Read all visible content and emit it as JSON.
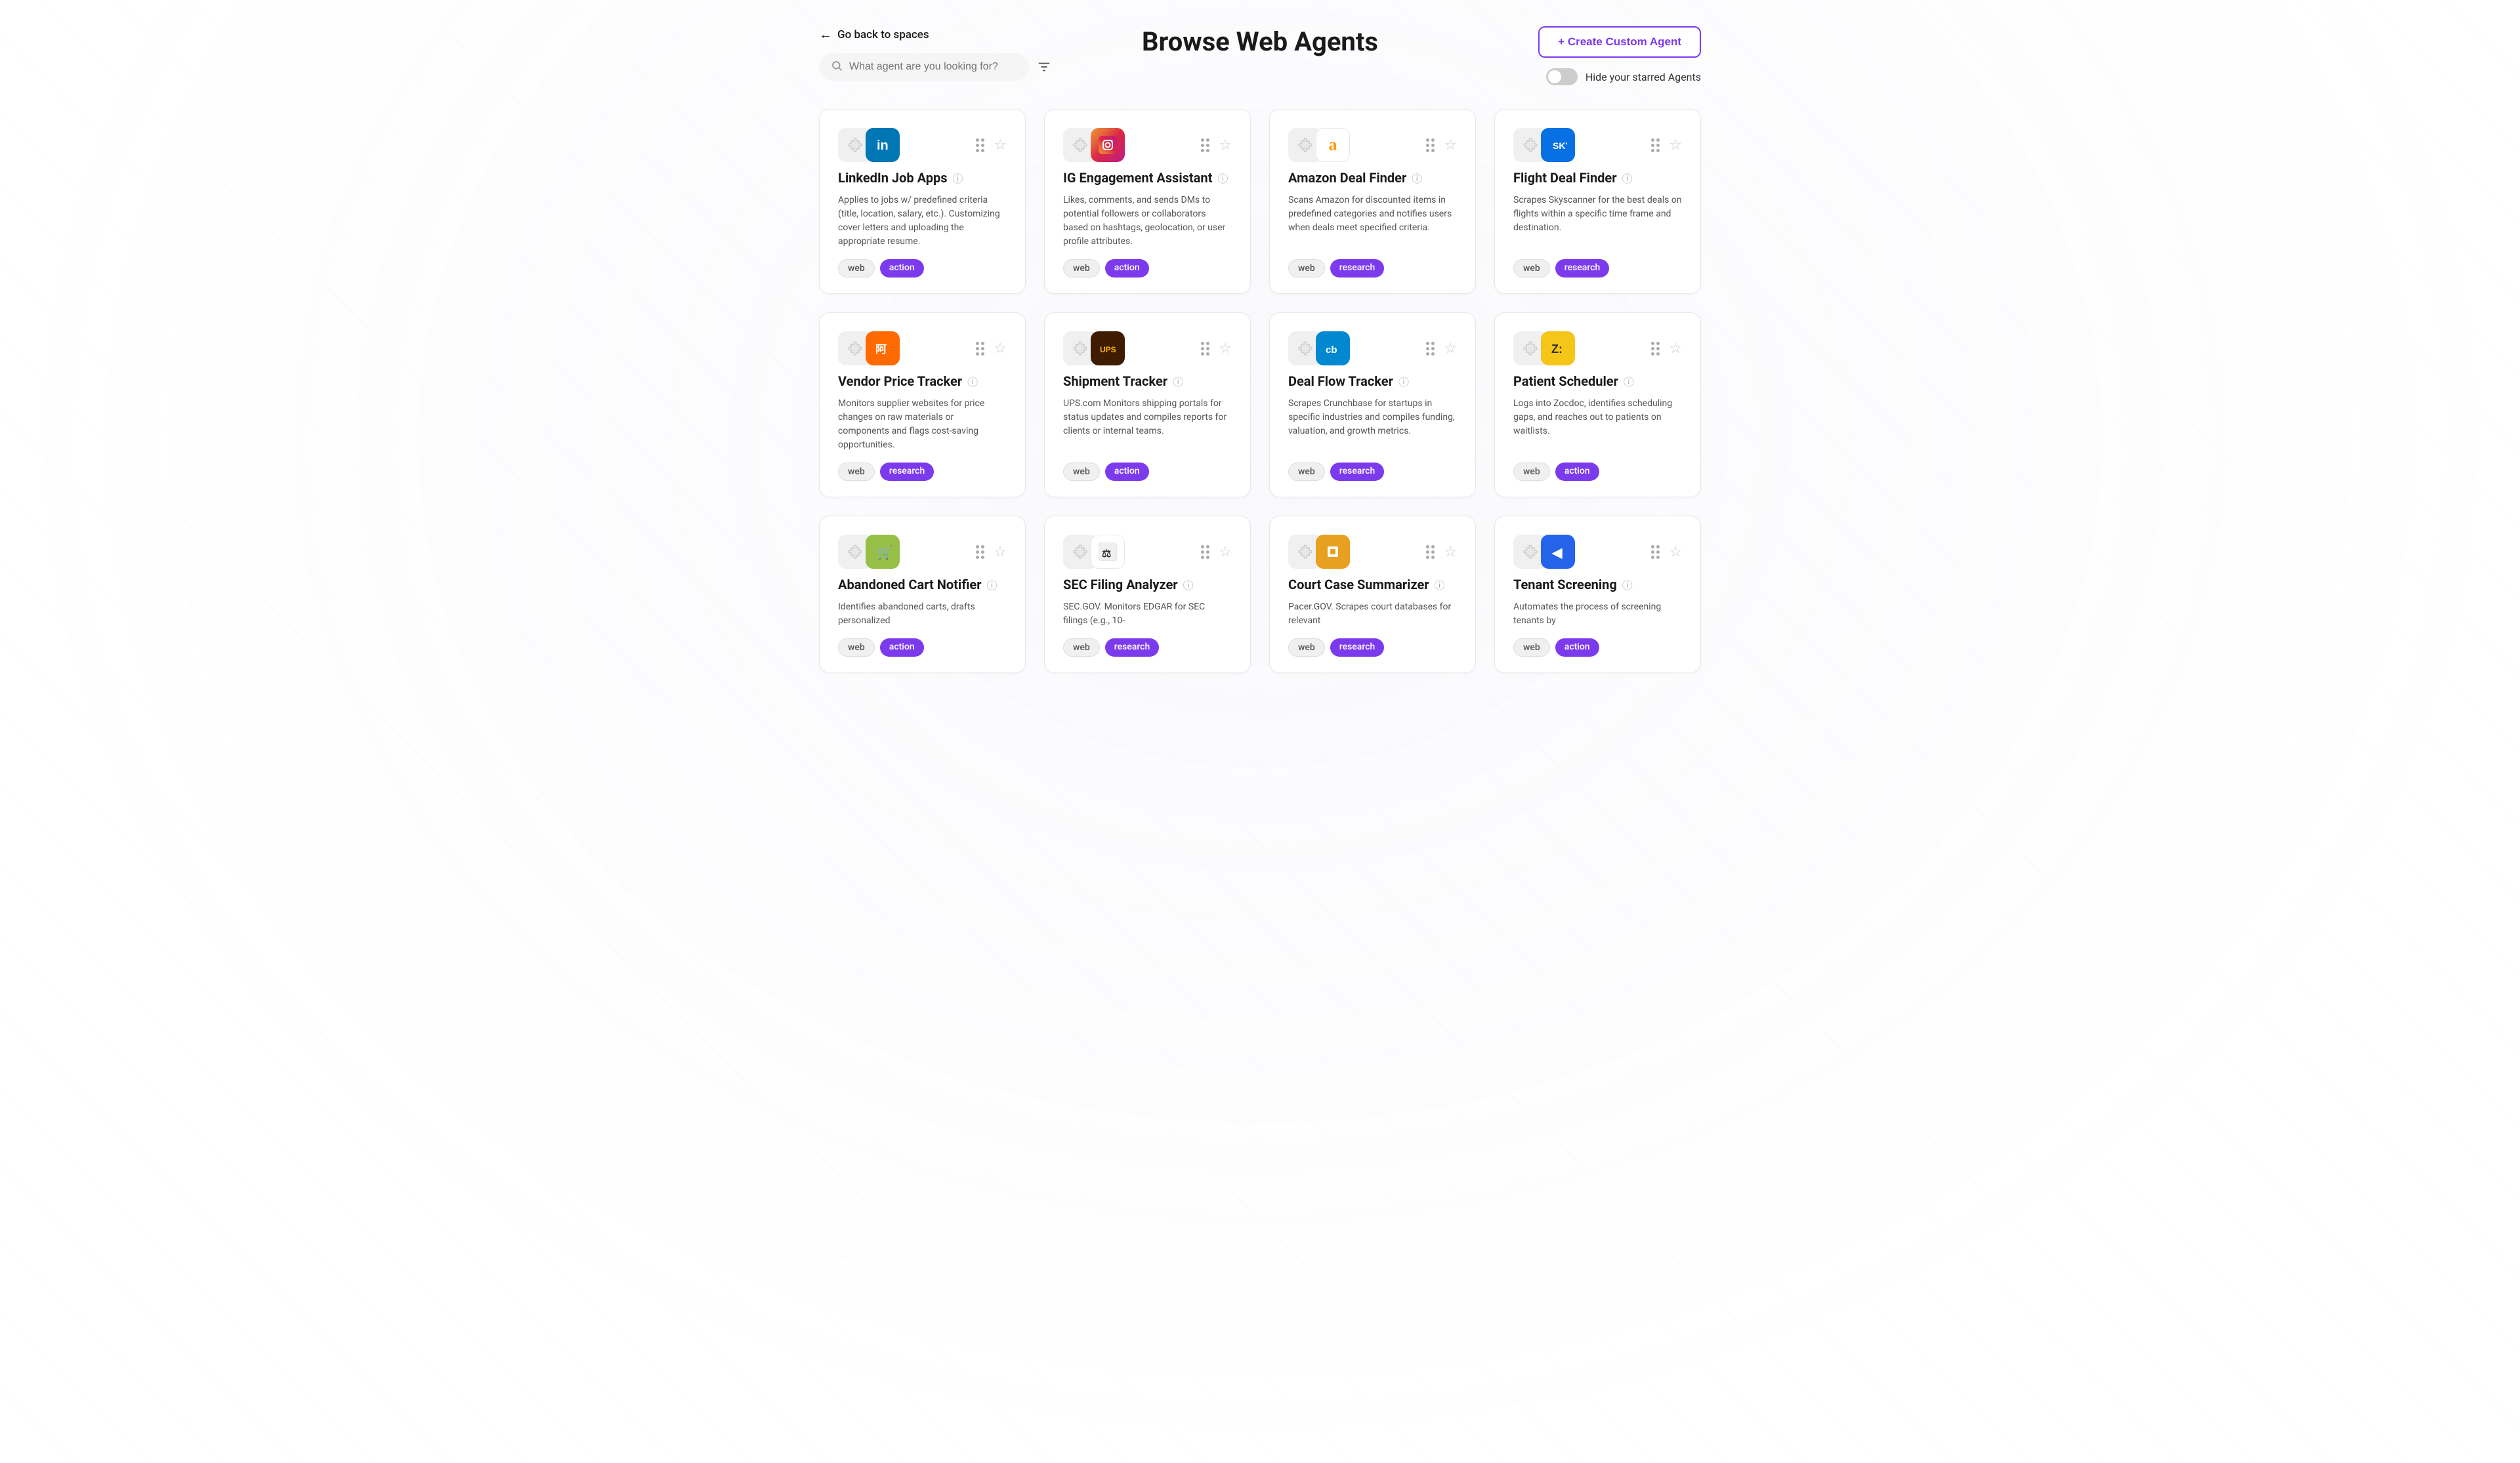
{
  "header": {
    "back_label": "Go back to spaces",
    "page_title": "Browse Web Agents",
    "search_placeholder": "What agent are you looking for?",
    "create_button_label": "+ Create Custom Agent",
    "hide_starred_label": "Hide your starred Agents"
  },
  "agents": [
    {
      "id": "linkedin-job-apps",
      "title": "LinkedIn Job Apps",
      "description": "Applies to jobs w/ predefined criteria (title, location, salary, etc.). Customizing cover letters and uploading the appropriate resume.",
      "brand_icon": "in",
      "brand_class": "brand-linkedin",
      "tags": [
        "web",
        "action"
      ]
    },
    {
      "id": "ig-engagement",
      "title": "IG Engagement Assistant",
      "description": "Likes, comments, and sends DMs to potential followers or collaborators based on hashtags, geolocation, or user profile attributes.",
      "brand_icon": "📷",
      "brand_class": "brand-instagram",
      "tags": [
        "web",
        "action"
      ]
    },
    {
      "id": "amazon-deal-finder",
      "title": "Amazon Deal Finder",
      "description": "Scans Amazon for discounted items in predefined categories and notifies users when deals meet specified criteria.",
      "brand_icon": "a",
      "brand_class": "brand-amazon",
      "tags": [
        "web",
        "research"
      ]
    },
    {
      "id": "flight-deal-finder",
      "title": "Flight Deal Finder",
      "description": "Scrapes Skyscanner for the best deals on flights within a specific time frame and destination.",
      "brand_icon": "✈",
      "brand_class": "brand-skyscanner",
      "tags": [
        "web",
        "research"
      ]
    },
    {
      "id": "vendor-price-tracker",
      "title": "Vendor Price Tracker",
      "description": "Monitors supplier websites for price changes on raw materials or components and flags cost-saving opportunities.",
      "brand_icon": "阿",
      "brand_class": "brand-alibaba",
      "tags": [
        "web",
        "research"
      ]
    },
    {
      "id": "shipment-tracker",
      "title": "Shipment Tracker",
      "description": "UPS.com Monitors shipping portals for status updates and compiles reports for clients or internal teams.",
      "brand_icon": "UPS",
      "brand_class": "brand-ups",
      "tags": [
        "web",
        "action"
      ]
    },
    {
      "id": "deal-flow-tracker",
      "title": "Deal Flow Tracker",
      "description": "Scrapes Crunchbase for startups in specific industries and compiles funding, valuation, and growth metrics.",
      "brand_icon": "cb",
      "brand_class": "brand-crunchbase",
      "tags": [
        "web",
        "research"
      ]
    },
    {
      "id": "patient-scheduler",
      "title": "Patient Scheduler",
      "description": "Logs into Zocdoc, identifies scheduling gaps, and reaches out to patients on waitlists.",
      "brand_icon": "Z:",
      "brand_class": "brand-zocdoc",
      "tags": [
        "web",
        "action"
      ]
    },
    {
      "id": "abandoned-cart-notifier",
      "title": "Abandoned Cart Notifier",
      "description": "Identifies abandoned carts, drafts personalized",
      "brand_icon": "🛍",
      "brand_class": "brand-shopify",
      "tags": [
        "web",
        "action"
      ]
    },
    {
      "id": "sec-filing-analyzer",
      "title": "SEC Filing Analyzer",
      "description": "SEC.GOV. Monitors EDGAR for SEC filings (e.g., 10-",
      "brand_icon": "⚖",
      "brand_class": "brand-sec",
      "tags": [
        "web",
        "research"
      ]
    },
    {
      "id": "court-case-summarizer",
      "title": "Court Case Summarizer",
      "description": "Pacer.GOV. Scrapes court databases for relevant",
      "brand_icon": "⬜",
      "brand_class": "brand-pacer",
      "tags": [
        "web",
        "research"
      ]
    },
    {
      "id": "tenant-screening",
      "title": "Tenant Screening",
      "description": "Automates the process of screening tenants by",
      "brand_icon": "◀",
      "brand_class": "brand-tenant",
      "tags": [
        "web",
        "action"
      ]
    }
  ]
}
